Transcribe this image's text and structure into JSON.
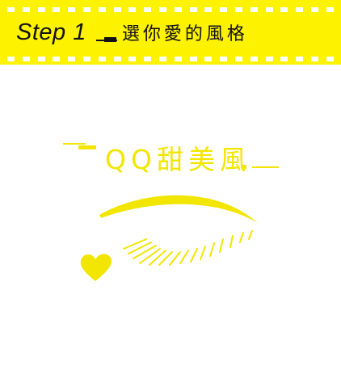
{
  "banner": {
    "step": "Step 1",
    "text": "選你愛的風格",
    "background": "#fdf200",
    "text_color": "#111111"
  },
  "style": {
    "label": "QQ甜美風",
    "accent_color": "#f2e600"
  },
  "illustration": {
    "icons": [
      "eyebrow-icon",
      "eyelash-icon",
      "heart-icon"
    ]
  }
}
